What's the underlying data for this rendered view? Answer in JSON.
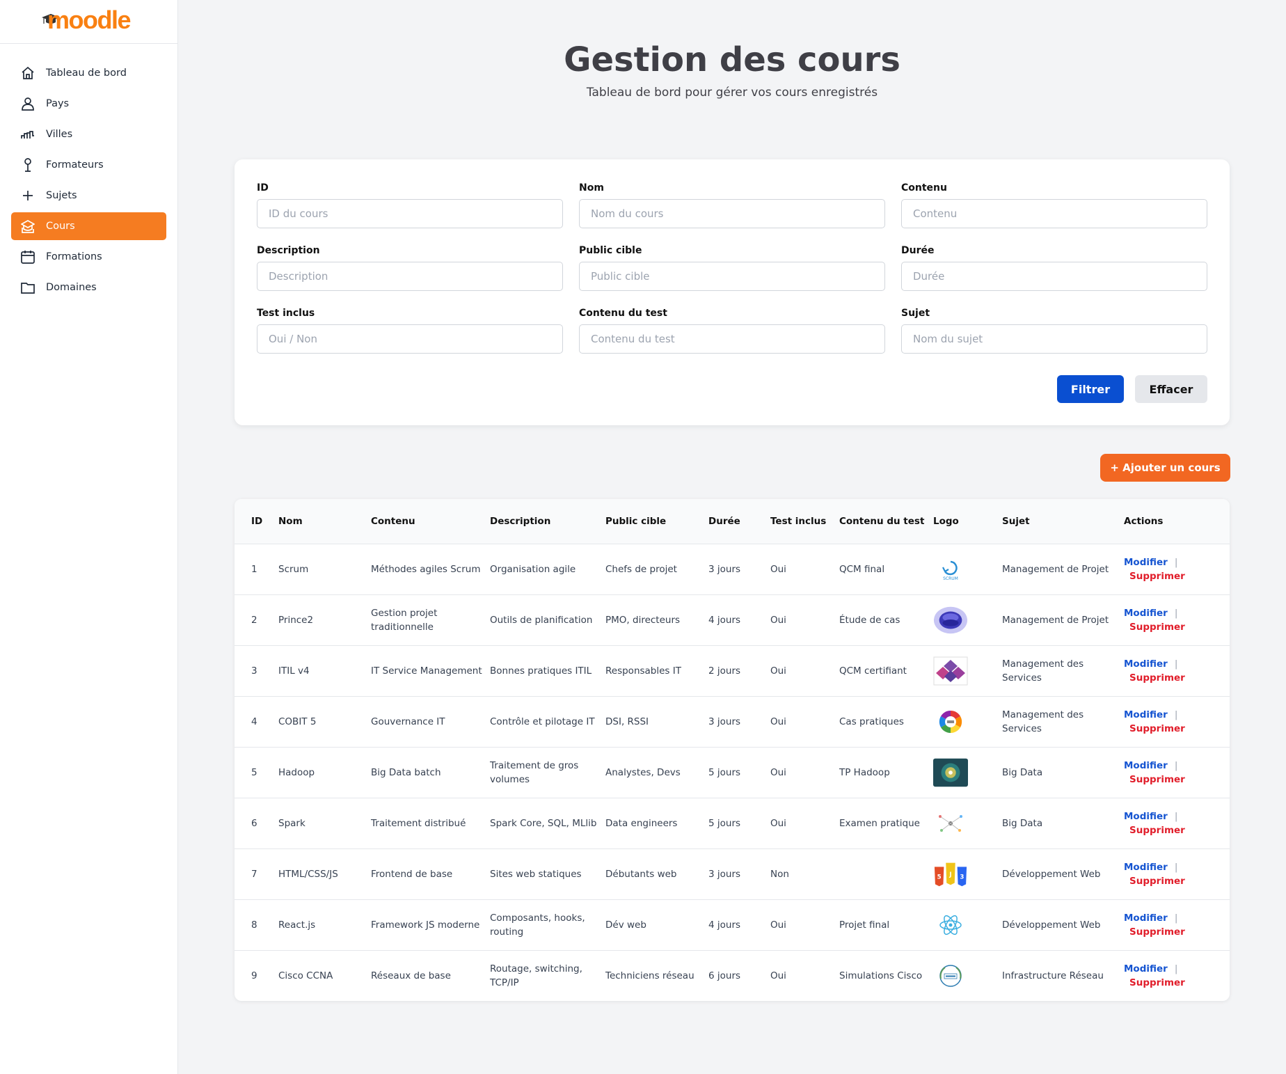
{
  "sidebar": {
    "logo": "moodle",
    "items": [
      {
        "label": "Tableau de bord",
        "icon": "home-icon"
      },
      {
        "label": "Pays",
        "icon": "user-icon"
      },
      {
        "label": "Villes",
        "icon": "chart-line-icon"
      },
      {
        "label": "Formateurs",
        "icon": "pin-icon"
      },
      {
        "label": "Sujets",
        "icon": "plus-icon"
      },
      {
        "label": "Cours",
        "icon": "course-icon",
        "active": true
      },
      {
        "label": "Formations",
        "icon": "calendar-icon"
      },
      {
        "label": "Domaines",
        "icon": "folder-icon"
      }
    ]
  },
  "header": {
    "title": "Gestion des cours",
    "subtitle": "Tableau de bord pour gérer vos cours enregistrés"
  },
  "filters": {
    "fields": [
      {
        "label": "ID",
        "placeholder": "ID du cours"
      },
      {
        "label": "Nom",
        "placeholder": "Nom du cours"
      },
      {
        "label": "Contenu",
        "placeholder": "Contenu"
      },
      {
        "label": "Description",
        "placeholder": "Description"
      },
      {
        "label": "Public cible",
        "placeholder": "Public cible"
      },
      {
        "label": "Durée",
        "placeholder": "Durée"
      },
      {
        "label": "Test inclus",
        "placeholder": "Oui / Non"
      },
      {
        "label": "Contenu du test",
        "placeholder": "Contenu du test"
      },
      {
        "label": "Sujet",
        "placeholder": "Nom du sujet"
      }
    ],
    "filter_label": "Filtrer",
    "clear_label": "Effacer"
  },
  "add_label": "+ Ajouter un cours",
  "table": {
    "columns": [
      "ID",
      "Nom",
      "Contenu",
      "Description",
      "Public cible",
      "Durée",
      "Test inclus",
      "Contenu du test",
      "Logo",
      "Sujet",
      "Actions"
    ],
    "modify_label": "Modifier",
    "separator": "|",
    "delete_label": "Supprimer",
    "rows": [
      {
        "id": "1",
        "nom": "Scrum",
        "contenu": "Méthodes agiles Scrum",
        "description": "Organisation agile",
        "public": "Chefs de projet",
        "duree": "3 jours",
        "test": "Oui",
        "contenu_test": "QCM final",
        "logo": "scrum-logo",
        "logo_text": "SCRUM",
        "sujet": "Management de Projet"
      },
      {
        "id": "2",
        "nom": "Prince2",
        "contenu": "Gestion projet traditionnelle",
        "description": "Outils de planification",
        "public": "PMO, directeurs",
        "duree": "4 jours",
        "test": "Oui",
        "contenu_test": "Étude de cas",
        "logo": "prince2-logo",
        "logo_text": "",
        "sujet": "Management de Projet"
      },
      {
        "id": "3",
        "nom": "ITIL v4",
        "contenu": "IT Service Management",
        "description": "Bonnes pratiques ITIL",
        "public": "Responsables IT",
        "duree": "2 jours",
        "test": "Oui",
        "contenu_test": "QCM certifiant",
        "logo": "itil-logo",
        "logo_text": "",
        "sujet": "Management des Services"
      },
      {
        "id": "4",
        "nom": "COBIT 5",
        "contenu": "Gouvernance IT",
        "description": "Contrôle et pilotage IT",
        "public": "DSI, RSSI",
        "duree": "3 jours",
        "test": "Oui",
        "contenu_test": "Cas pratiques",
        "logo": "cobit-logo",
        "logo_text": "",
        "sujet": "Management des Services"
      },
      {
        "id": "5",
        "nom": "Hadoop",
        "contenu": "Big Data batch",
        "description": "Traitement de gros volumes",
        "public": "Analystes, Devs",
        "duree": "5 jours",
        "test": "Oui",
        "contenu_test": "TP Hadoop",
        "logo": "hadoop-logo",
        "logo_text": "",
        "sujet": "Big Data"
      },
      {
        "id": "6",
        "nom": "Spark",
        "contenu": "Traitement distribué",
        "description": "Spark Core, SQL, MLlib",
        "public": "Data engineers",
        "duree": "5 jours",
        "test": "Oui",
        "contenu_test": "Examen pratique",
        "logo": "spark-logo",
        "logo_text": "",
        "sujet": "Big Data"
      },
      {
        "id": "7",
        "nom": "HTML/CSS/JS",
        "contenu": "Frontend de base",
        "description": "Sites web statiques",
        "public": "Débutants web",
        "duree": "3 jours",
        "test": "Non",
        "contenu_test": "",
        "logo": "html-css-js-logo",
        "logo_text": "",
        "sujet": "Développement Web"
      },
      {
        "id": "8",
        "nom": "React.js",
        "contenu": "Framework JS moderne",
        "description": "Composants, hooks, routing",
        "public": "Dév web",
        "duree": "4 jours",
        "test": "Oui",
        "contenu_test": "Projet final",
        "logo": "react-logo",
        "logo_text": "",
        "sujet": "Développement Web"
      },
      {
        "id": "9",
        "nom": "Cisco CCNA",
        "contenu": "Réseaux de base",
        "description": "Routage, switching, TCP/IP",
        "public": "Techniciens réseau",
        "duree": "6 jours",
        "test": "Oui",
        "contenu_test": "Simulations Cisco",
        "logo": "ccna-logo",
        "logo_text": "",
        "sujet": "Infrastructure Réseau"
      }
    ]
  },
  "colors": {
    "accent": "#f57c21",
    "primary": "#0a4fd1",
    "danger": "#e11d2a"
  }
}
